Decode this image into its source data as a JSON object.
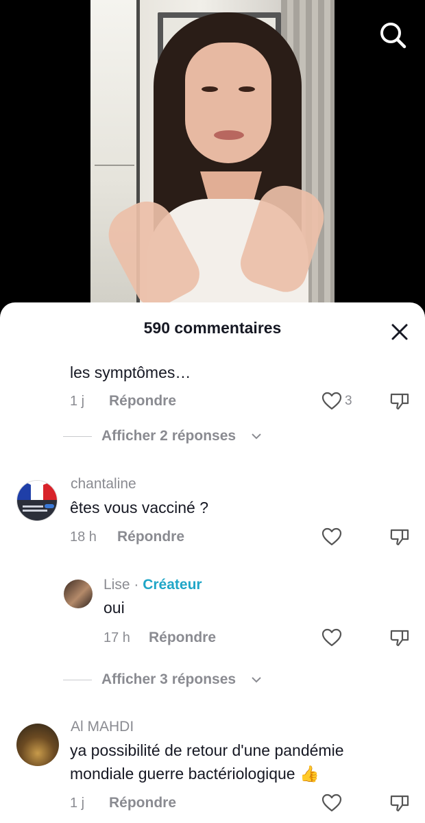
{
  "sheet": {
    "title": "590 commentaires"
  },
  "comments": [
    {
      "text": "les symptômes…",
      "time": "1 j",
      "reply_label": "Répondre",
      "likes": "3",
      "more_replies": "Afficher 2 réponses"
    },
    {
      "username": "chantaline",
      "text": "êtes vous vacciné ?",
      "time": "18 h",
      "reply_label": "Répondre",
      "replies": [
        {
          "username": "Lise",
          "separator": "·",
          "badge": "Créateur",
          "text": "oui",
          "time": "17 h",
          "reply_label": "Répondre"
        }
      ],
      "more_replies": "Afficher 3 réponses"
    },
    {
      "username": "Al MAHDI",
      "text_line1": "ya possibilité de retour d'une pandémie",
      "text_line2": "mondiale guerre bactériologique 👍",
      "time": "1 j",
      "reply_label": "Répondre"
    }
  ],
  "icons": {
    "search": "search-icon",
    "close": "close-icon",
    "like": "heart-outline-icon",
    "dislike": "thumbs-down-icon",
    "expand": "chevron-down-icon"
  },
  "colors": {
    "accent_creator": "#20a6c7",
    "text_primary": "#161823",
    "text_secondary": "#8a8b91"
  }
}
